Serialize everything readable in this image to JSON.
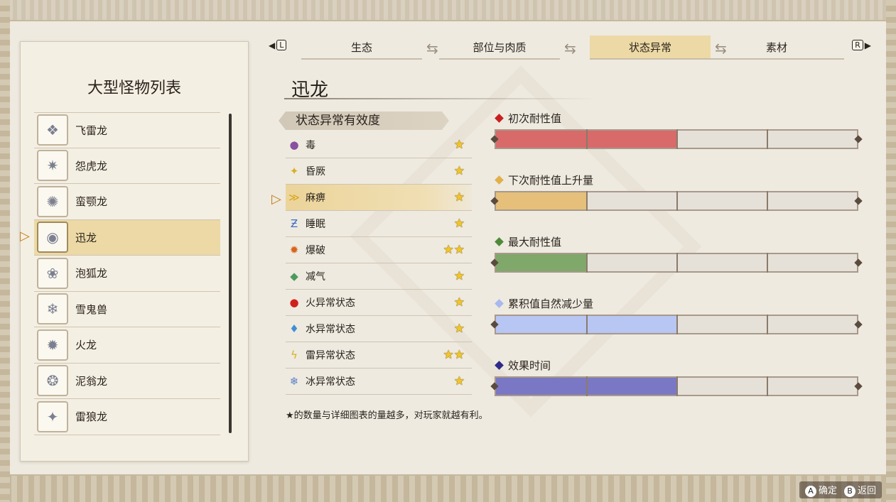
{
  "left_panel": {
    "title": "大型怪物列表",
    "monsters": [
      {
        "name": "飞雷龙"
      },
      {
        "name": "怨虎龙"
      },
      {
        "name": "蛮颚龙"
      },
      {
        "name": "迅龙"
      },
      {
        "name": "泡狐龙"
      },
      {
        "name": "雪鬼兽"
      },
      {
        "name": "火龙"
      },
      {
        "name": "泥翁龙"
      },
      {
        "name": "雷狼龙"
      }
    ],
    "selected_index": 3
  },
  "tabs": {
    "left_key": "L",
    "right_key": "R",
    "items": [
      {
        "label": "生态"
      },
      {
        "label": "部位与肉质"
      },
      {
        "label": "状态异常"
      },
      {
        "label": "素材"
      }
    ],
    "active_index": 2
  },
  "monster_name": "迅龙",
  "ailments": {
    "header": "状态异常有效度",
    "rows": [
      {
        "name": "毒",
        "stars": "★",
        "icon": "poison-icon"
      },
      {
        "name": "昏厥",
        "stars": "★",
        "icon": "stun-icon"
      },
      {
        "name": "麻痹",
        "stars": "★",
        "icon": "paralysis-icon"
      },
      {
        "name": "睡眠",
        "stars": "★",
        "icon": "sleep-icon"
      },
      {
        "name": "爆破",
        "stars": "★★",
        "icon": "blast-icon"
      },
      {
        "name": "减气",
        "stars": "★",
        "icon": "exhaust-icon"
      },
      {
        "name": "火异常状态",
        "stars": "★",
        "icon": "fireblight-icon"
      },
      {
        "name": "水异常状态",
        "stars": "★",
        "icon": "waterblight-icon"
      },
      {
        "name": "雷异常状态",
        "stars": "★★",
        "icon": "thunderblight-icon"
      },
      {
        "name": "冰异常状态",
        "stars": "★",
        "icon": "iceblight-icon"
      }
    ],
    "selected_index": 2,
    "note": "★的数量与详细图表的量越多，对玩家就越有利。"
  },
  "stats": [
    {
      "label": "初次耐性值",
      "marker_color": "#c8201e",
      "fill_color": "#d86a6a",
      "fill_fraction": 0.5
    },
    {
      "label": "下次耐性值上升量",
      "marker_color": "#e2b04a",
      "fill_color": "#e6c07a",
      "fill_fraction": 0.25
    },
    {
      "label": "最大耐性值",
      "marker_color": "#4e8a3a",
      "fill_color": "#7fa86a",
      "fill_fraction": 0.25
    },
    {
      "label": "累积值自然减少量",
      "marker_color": "#a9b8ef",
      "fill_color": "#b8c6f4",
      "fill_fraction": 0.5
    },
    {
      "label": "效果时间",
      "marker_color": "#2d2a8a",
      "fill_color": "#7a78c4",
      "fill_fraction": 0.5
    }
  ],
  "footer": {
    "confirm_key": "A",
    "confirm_label": "确定",
    "back_key": "B",
    "back_label": "返回"
  }
}
